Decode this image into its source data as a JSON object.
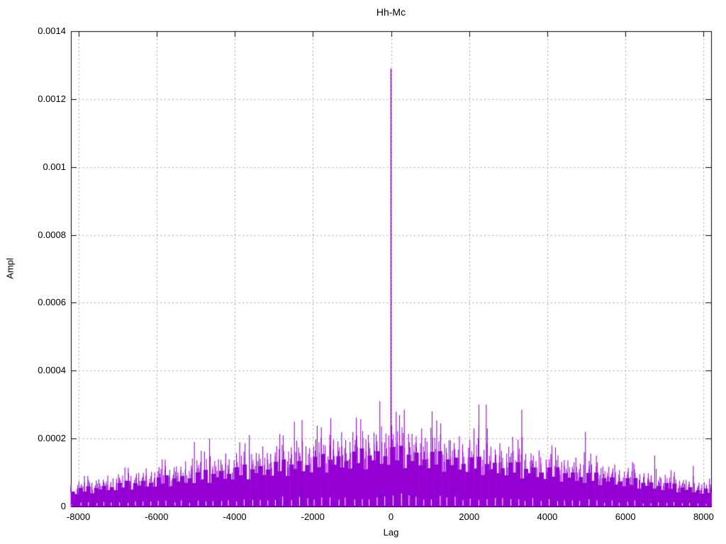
{
  "page": {
    "background": "#ffffff"
  },
  "chart_data": {
    "type": "impulses",
    "title": "Hh-Mc",
    "xlabel": "Lag",
    "ylabel": "Ampl",
    "xlim": [
      -8192,
      8192
    ],
    "ylim": [
      0,
      0.0014
    ],
    "x_tick_values": [
      -8000,
      -6000,
      -4000,
      -2000,
      0,
      2000,
      4000,
      6000,
      8000
    ],
    "x_tick_labels": [
      "-8000",
      "-6000",
      "-4000",
      "-2000",
      "0",
      "2000",
      "4000",
      "6000",
      "8000"
    ],
    "y_tick_values": [
      0,
      0.0002,
      0.0004,
      0.0006,
      0.0008,
      0.001,
      0.0012,
      0.0014
    ],
    "y_tick_labels": [
      "0",
      "0.0002",
      "0.0004",
      "0.0006",
      "0.0008",
      "0.001",
      "0.0012",
      "0.0014"
    ],
    "grid": true,
    "legend": "none",
    "colors": {
      "series": "#9400d3",
      "grid": "#a0a0a0",
      "frame": "#000000",
      "text": "#000000"
    },
    "peak": {
      "x": 0,
      "amplitude": 0.00129
    },
    "impulses": {
      "amplitude_scale": 1e-06,
      "x_start": -8150,
      "x_step": 100,
      "base": [
        44,
        37,
        55,
        44,
        60,
        39,
        55,
        50,
        61,
        48,
        57,
        48,
        70,
        56,
        76,
        50,
        69,
        62,
        76,
        59,
        70,
        59,
        86,
        68,
        92,
        60,
        83,
        74,
        90,
        70,
        83,
        69,
        101,
        80,
        108,
        70,
        96,
        87,
        105,
        82,
        96,
        80,
        116,
        92,
        124,
        80,
        110,
        99,
        119,
        93,
        109,
        91,
        132,
        104,
        139,
        90,
        124,
        111,
        134,
        104,
        122,
        101,
        147,
        116,
        155,
        100,
        138,
        123,
        148,
        115,
        135,
        112,
        162,
        128,
        171,
        110,
        151,
        136,
        163,
        126,
        148,
        123,
        176,
        136,
        179,
        113,
        153,
        134,
        159,
        121,
        139,
        113,
        161,
        124,
        163,
        103,
        139,
        122,
        144,
        109,
        126,
        102,
        145,
        112,
        147,
        93,
        125,
        110,
        129,
        98,
        113,
        92,
        130,
        100,
        131,
        83,
        111,
        98,
        115,
        87,
        100,
        81,
        115,
        88,
        116,
        73,
        98,
        85,
        100,
        76,
        87,
        70,
        99,
        76,
        100,
        63,
        84,
        73,
        86,
        65,
        74,
        60,
        84,
        64,
        84,
        53,
        70,
        61,
        71,
        53,
        61,
        49,
        69,
        52,
        68,
        42,
        56,
        49,
        57,
        42,
        48,
        38,
        53,
        40
      ],
      "spike": [
        64,
        63,
        74,
        90,
        90,
        70,
        77,
        80,
        79,
        91,
        83,
        82,
        95,
        115,
        114,
        90,
        97,
        99,
        99,
        112,
        102,
        100,
        116,
        139,
        138,
        108,
        116,
        118,
        117,
        133,
        120,
        190,
        136,
        164,
        162,
        200,
        134,
        139,
        137,
        156,
        139,
        136,
        157,
        189,
        186,
        210,
        154,
        158,
        155,
        177,
        158,
        155,
        178,
        213,
        209,
        162,
        174,
        250,
        174,
        255,
        177,
        172,
        198,
        238,
        233,
        180,
        260,
        197,
        192,
        219,
        196,
        190,
        219,
        262,
        257,
        198,
        211,
        218,
        212,
        310,
        215,
        209,
        238,
        279,
        269,
        285,
        214,
        214,
        207,
        230,
        202,
        192,
        280,
        254,
        245,
        185,
        195,
        195,
        187,
        207,
        183,
        173,
        196,
        230,
        300,
        167,
        300,
        176,
        168,
        186,
        164,
        156,
        176,
        205,
        197,
        285,
        155,
        157,
        150,
        165,
        145,
        138,
        155,
        180,
        174,
        131,
        137,
        136,
        130,
        144,
        126,
        220,
        134,
        156,
        150,
        113,
        118,
        117,
        112,
        124,
        107,
        102,
        113,
        131,
        126,
        95,
        98,
        98,
        92,
        150,
        88,
        83,
        93,
        107,
        102,
        76,
        78,
        78,
        74,
        120,
        70,
        65,
        72,
        82
      ]
    }
  }
}
